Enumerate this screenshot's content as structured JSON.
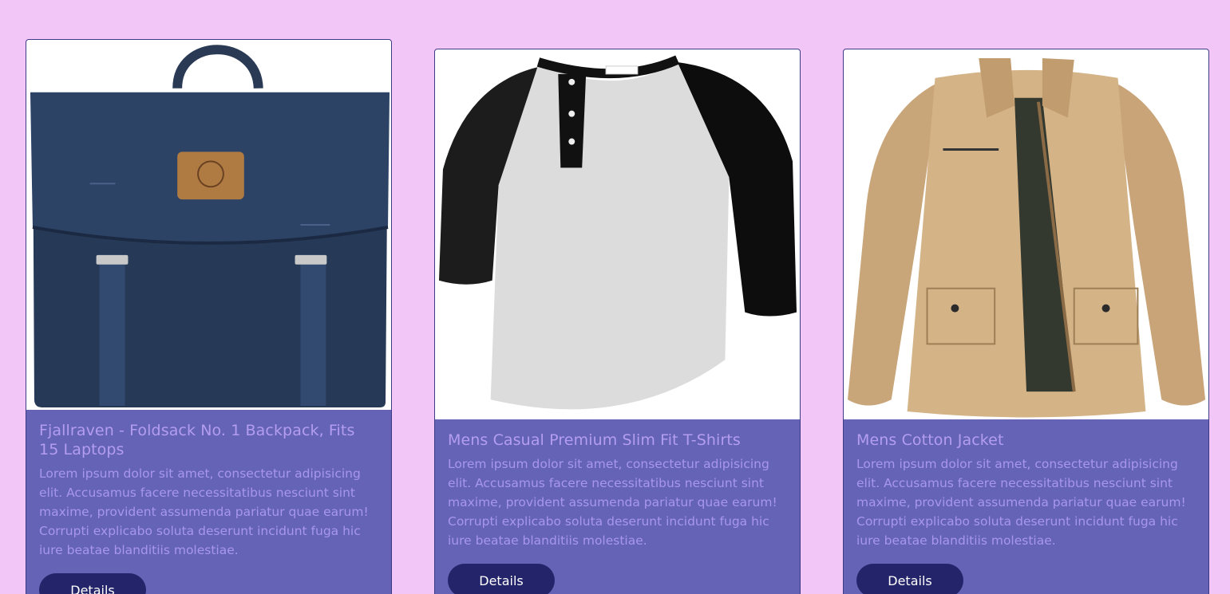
{
  "products": [
    {
      "title": "Fjallraven - Foldsack No. 1 Backpack, Fits 15 Laptops",
      "description": "Lorem ipsum dolor sit amet, consectetur adipisicing elit. Accusamus facere necessitatibus nesciunt sint maxime, provident assumenda pariatur quae earum! Corrupti explicabo soluta deserunt incidunt fuga hic iure beatae blanditiis molestiae.",
      "button_label": "Details",
      "image": "backpack-photo"
    },
    {
      "title": "Mens Casual Premium Slim Fit T-Shirts",
      "description": "Lorem ipsum dolor sit amet, consectetur adipisicing elit. Accusamus facere necessitatibus nesciunt sint maxime, provident assumenda pariatur quae earum! Corrupti explicabo soluta deserunt incidunt fuga hic iure beatae blanditiis molestiae.",
      "button_label": "Details",
      "image": "tshirt-photo"
    },
    {
      "title": "Mens Cotton Jacket",
      "description": "Lorem ipsum dolor sit amet, consectetur adipisicing elit. Accusamus facere necessitatibus nesciunt sint maxime, provident assumenda pariatur quae earum! Corrupti explicabo soluta deserunt incidunt fuga hic iure beatae blanditiis molestiae.",
      "button_label": "Details",
      "image": "jacket-photo"
    }
  ],
  "colors": {
    "page_background": "#f2c6f6",
    "card_body": "#6463b6",
    "title_text": "#b49df0",
    "button_background": "#24246a",
    "button_text": "#ffffff"
  }
}
